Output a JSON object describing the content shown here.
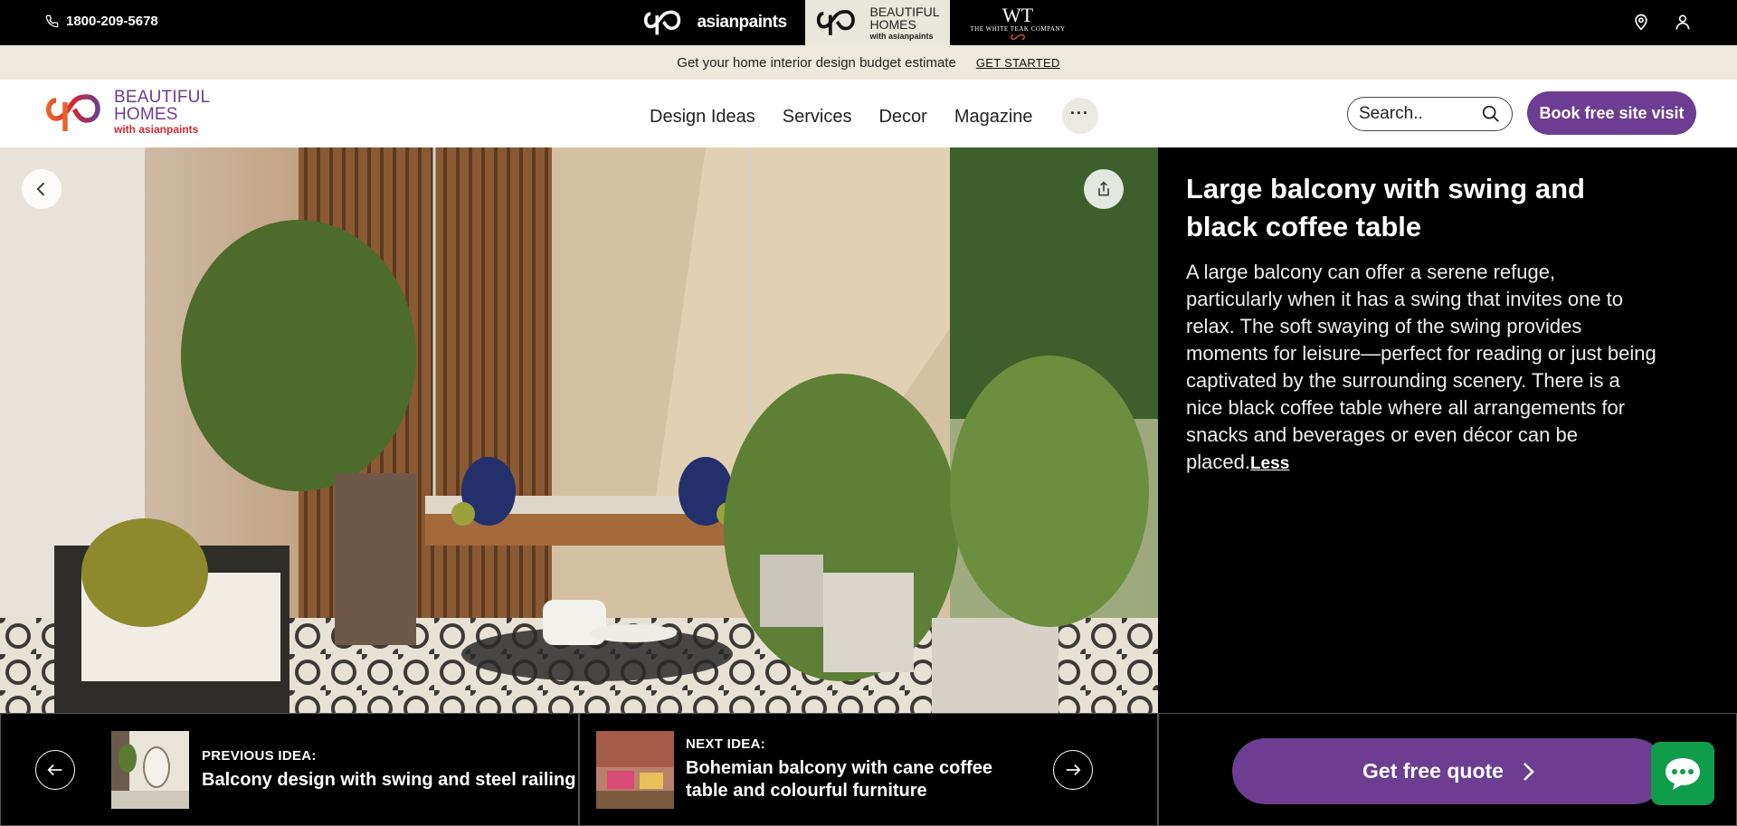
{
  "topbar": {
    "phone": "1800-209-5678",
    "brands": {
      "asianpaints": "asianpaints",
      "beautiful_homes_line1": "BEAUTIFUL",
      "beautiful_homes_line2": "HOMES",
      "beautiful_homes_sub": "with asianpaints",
      "white_teak_big": "WT",
      "white_teak_small": "THE WHITE TEAK COMPANY"
    },
    "icons": [
      "location-pin-icon",
      "user-icon"
    ]
  },
  "promo": {
    "text": "Get your home interior design budget estimate",
    "link": "GET STARTED"
  },
  "nav": {
    "logo_line1": "BEAUTIFUL",
    "logo_line2": "HOMES",
    "logo_line3": "with asianpaints",
    "items": [
      "Design Ideas",
      "Services",
      "Decor",
      "Magazine"
    ],
    "more": "···",
    "search_placeholder": "Search..",
    "book_button": "Book free site visit"
  },
  "idea": {
    "title": "Large balcony with swing and black coffee table",
    "description": "A large balcony can offer a serene refuge, particularly when it has a swing that invites one to relax. The soft swaying of the swing provides moments for leisure—perfect for reading or just being captivated by the surrounding scenery. There is a nice black coffee table where all arrangements for snacks and beverages or even décor can be placed.",
    "less_link": "Less"
  },
  "bottom": {
    "previous_label": "PREVIOUS IDEA:",
    "previous_title": "Balcony design with swing and steel railing",
    "next_label": "NEXT IDEA:",
    "next_title": "Bohemian balcony with cane coffee table and colourful furniture",
    "quote_button": "Get free quote"
  },
  "colors": {
    "brand_purple": "#6c3d91",
    "promo_bg": "#ede9dd",
    "chat_green": "#0f9d49"
  }
}
